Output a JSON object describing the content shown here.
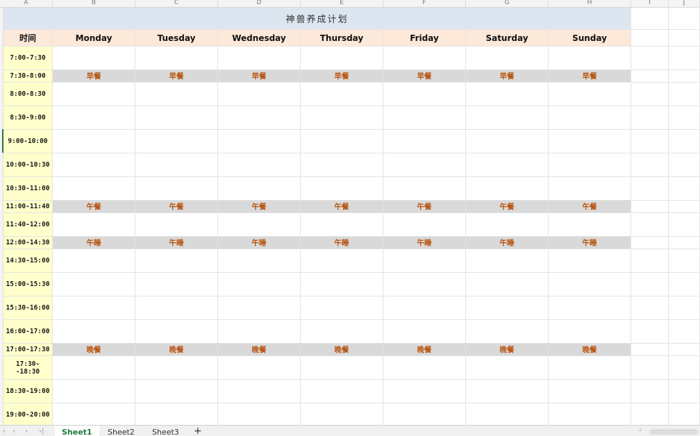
{
  "column_headers": [
    "A",
    "B",
    "C",
    "D",
    "E",
    "F",
    "G",
    "H",
    "I",
    "J"
  ],
  "sheet": {
    "title": "神兽养成计划",
    "time_header": "时间",
    "days": [
      "Monday",
      "Tuesday",
      "Wednesday",
      "Thursday",
      "Friday",
      "Saturday",
      "Sunday"
    ],
    "rows": [
      {
        "time": "7:00-7:30",
        "meal": ""
      },
      {
        "time": "7:30-8:00",
        "meal": "早餐"
      },
      {
        "time": "8:00-8:30",
        "meal": ""
      },
      {
        "time": "8:30-9:00",
        "meal": ""
      },
      {
        "time": "9:00-10:00",
        "meal": ""
      },
      {
        "time": "10:00-10:30",
        "meal": ""
      },
      {
        "time": "10:30-11:00",
        "meal": ""
      },
      {
        "time": "11:00-11:40",
        "meal": "午餐"
      },
      {
        "time": "11:40-12:00",
        "meal": ""
      },
      {
        "time": "12:00-14:30",
        "meal": "午睡"
      },
      {
        "time": "14:30-15:00",
        "meal": ""
      },
      {
        "time": "15:00-15:30",
        "meal": ""
      },
      {
        "time": "15:30-16:00",
        "meal": ""
      },
      {
        "time": "16:00-17:00",
        "meal": ""
      },
      {
        "time": "17:00-17:30",
        "meal": "晚餐"
      },
      {
        "time": "17:30--18:30",
        "meal": ""
      },
      {
        "time": "18:30-19:00",
        "meal": ""
      },
      {
        "time": "19:00-20:00",
        "meal": ""
      }
    ]
  },
  "tabs": {
    "sheets": [
      "Sheet1",
      "Sheet2",
      "Sheet3"
    ],
    "active": "Sheet1",
    "add_label": "+",
    "nav_icons": [
      "first-icon",
      "prev-icon",
      "next-icon",
      "last-icon"
    ]
  },
  "colors": {
    "title_bg": "#dce6f1",
    "header_bg": "#fde9d9",
    "time_bg": "#ffffcc",
    "meal_bg": "#d9d9d9",
    "meal_text": "#b8520c",
    "active_tab": "#1c7a3a"
  }
}
